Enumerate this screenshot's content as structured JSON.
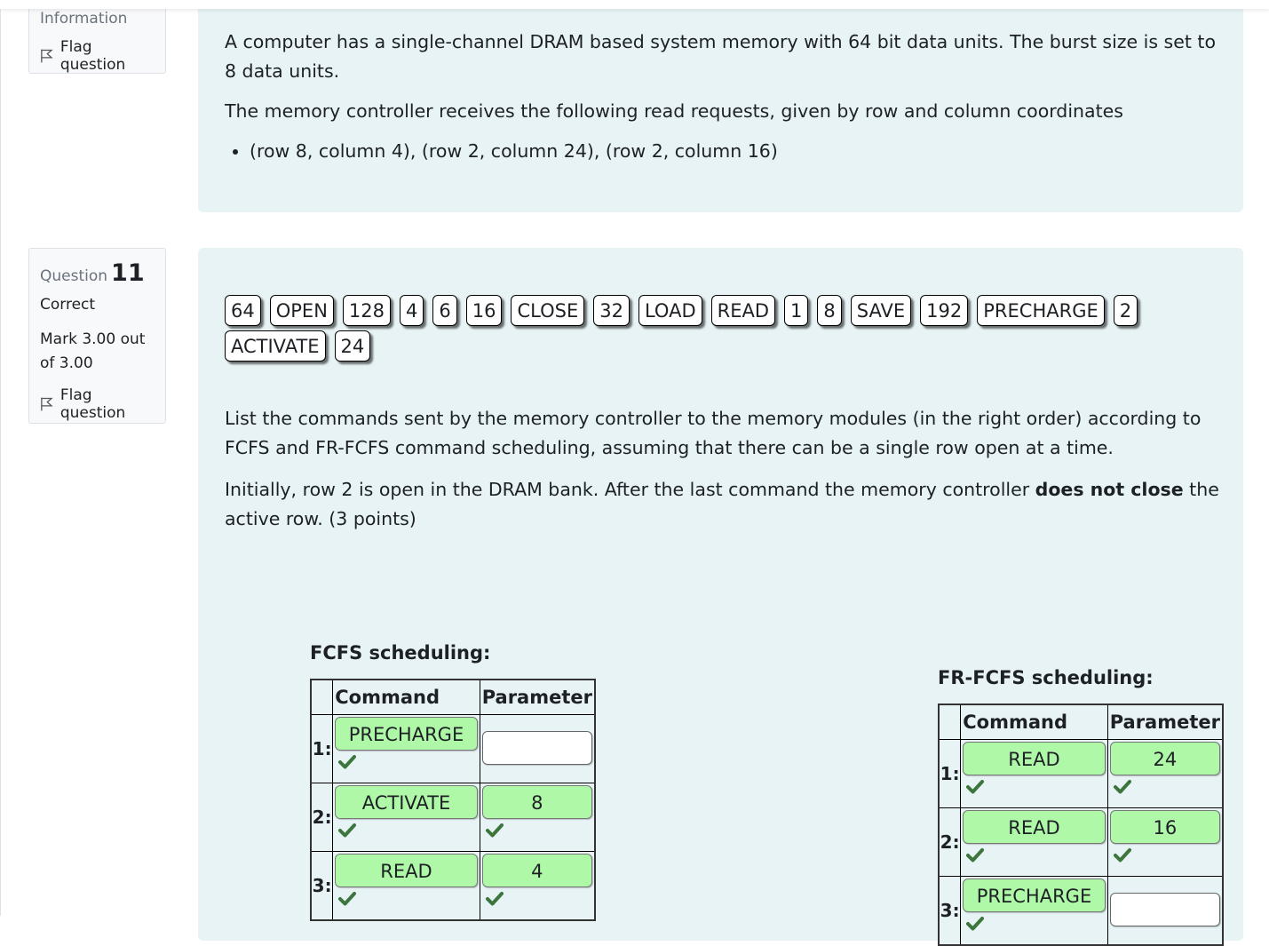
{
  "info_card": {
    "label": "Information",
    "flag": "Flag question"
  },
  "info_text": {
    "p1": "A computer has a single-channel DRAM based system memory with 64 bit data units. The burst size is set to 8 data units.",
    "p2": "The memory controller receives the following read requests, given by row and column coordinates",
    "bullet": "(row 8, column 4), (row 2, column 24), (row 2, column 16)"
  },
  "question": {
    "label": "Question",
    "number": "11",
    "status": "Correct",
    "mark": "Mark 3.00 out of 3.00",
    "flag": "Flag question",
    "drag_items": [
      "64",
      "OPEN",
      "128",
      "4",
      "6",
      "16",
      "CLOSE",
      "32",
      "LOAD",
      "READ",
      "1",
      "8",
      "SAVE",
      "192",
      "PRECHARGE",
      "2",
      "ACTIVATE",
      "24"
    ],
    "p1": "List the commands sent by the memory controller to the memory modules (in the right order) according to FCFS and FR-FCFS command scheduling, assuming that there can be a single row open at a time.",
    "p2_before": "Initially, row 2 is open in the DRAM bank. After the last command the memory controller ",
    "p2_bold": "does not close",
    "p2_after": " the active row. (3 points)"
  },
  "fcfs": {
    "title": "FCFS scheduling:",
    "col_command": "Command",
    "col_parameter": "Parameter",
    "rows": [
      {
        "num": "1:",
        "command": "PRECHARGE",
        "parameter": ""
      },
      {
        "num": "2:",
        "command": "ACTIVATE",
        "parameter": "8"
      },
      {
        "num": "3:",
        "command": "READ",
        "parameter": "4"
      }
    ]
  },
  "frfcfs": {
    "title": "FR-FCFS scheduling:",
    "col_command": "Command",
    "col_parameter": "Parameter",
    "rows": [
      {
        "num": "1:",
        "command": "READ",
        "parameter": "24"
      },
      {
        "num": "2:",
        "command": "READ",
        "parameter": "16"
      },
      {
        "num": "3:",
        "command": "PRECHARGE",
        "parameter": ""
      }
    ]
  },
  "colors": {
    "correct_fill": "#aff8a8",
    "check": "#3c763d",
    "panel_bg": "#e7f3f5"
  },
  "icons": {
    "flag": "flag-outline-icon",
    "check": "check-icon"
  }
}
